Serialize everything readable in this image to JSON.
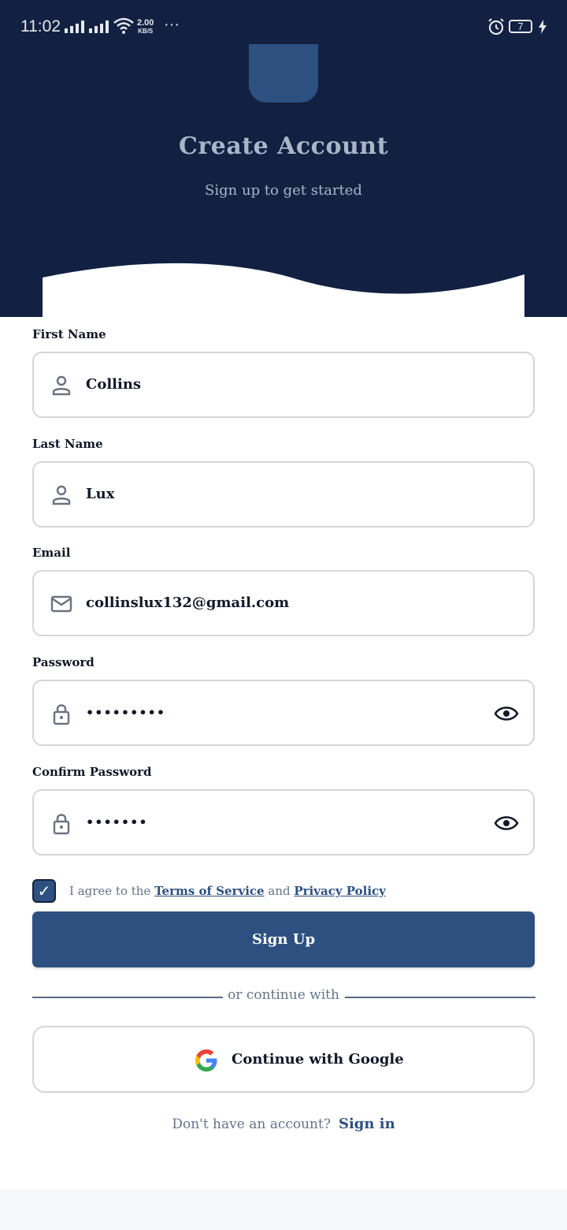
{
  "status_bar": {
    "time": "11:02",
    "net_speed_value": "2.00",
    "net_speed_unit": "KB/S",
    "more": "···",
    "battery": "7"
  },
  "header": {
    "title": "Create Account",
    "subtitle": "Sign up to get started"
  },
  "form": {
    "first_name": {
      "label": "First Name",
      "value": "Collins",
      "icon": "person-icon"
    },
    "last_name": {
      "label": "Last Name",
      "value": "Lux",
      "icon": "person-icon"
    },
    "email": {
      "label": "Email",
      "value": "collinslux132@gmail.com",
      "icon": "mail-icon"
    },
    "password": {
      "label": "Password",
      "value": "•••••••••",
      "icon": "lock-icon"
    },
    "confirm_password": {
      "label": "Confirm Password",
      "value": "•••••••",
      "icon": "lock-icon"
    }
  },
  "agree": {
    "checked": true,
    "check_mark": "✓",
    "prefix": "I agree to the",
    "terms": "Terms of Service",
    "and": "and",
    "privacy": "Privacy Policy"
  },
  "signup_label": "Sign Up",
  "divider_text": "or continue with",
  "google_label": "Continue with Google",
  "footer": {
    "prompt": "Don't have an account?",
    "signin": "Sign in"
  },
  "colors": {
    "header_bg": "#122142",
    "primary": "#2d5081",
    "muted_text": "#64748b",
    "border": "#d4d6da"
  }
}
